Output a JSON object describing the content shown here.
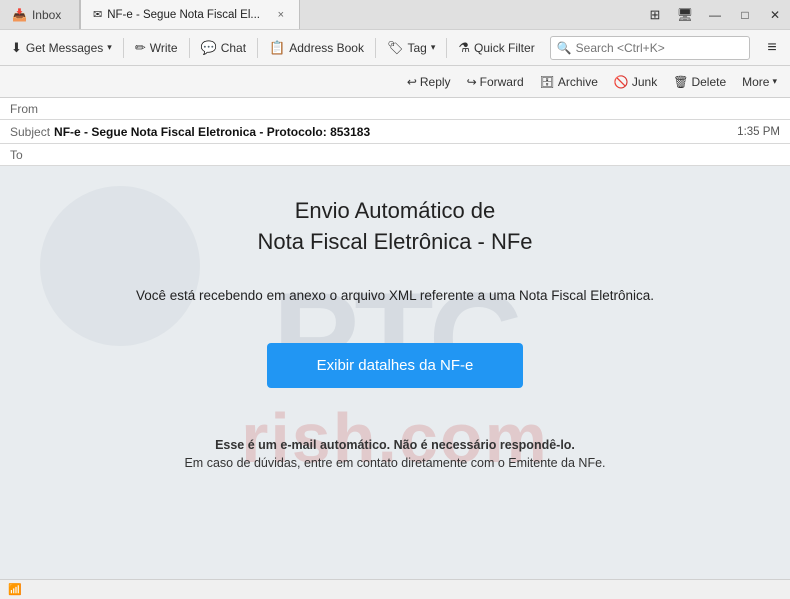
{
  "titlebar": {
    "tab_inactive_label": "Inbox",
    "tab_inactive_icon": "📥",
    "tab_active_label": "NF-e - Segue Nota Fiscal El...",
    "tab_active_close": "×",
    "window_controls": {
      "minimize": "—",
      "maximize": "□",
      "close": "✕"
    },
    "extra_icon": "⊞",
    "extra_icon2": "🖥"
  },
  "toolbar": {
    "get_messages": "Get Messages",
    "write": "Write",
    "chat": "Chat",
    "address_book": "Address Book",
    "tag": "Tag",
    "quick_filter": "Quick Filter",
    "search_placeholder": "Search <Ctrl+K>",
    "menu_icon": "≡"
  },
  "email_actions": {
    "reply": "Reply",
    "forward": "Forward",
    "archive": "Archive",
    "junk": "Junk",
    "delete": "Delete",
    "more": "More"
  },
  "email_header": {
    "from_label": "From",
    "subject_label": "Subject",
    "subject_value": "NF-e - Segue Nota Fiscal Eletronica - Protocolo: 853183",
    "time": "1:35 PM",
    "to_label": "To"
  },
  "email_body": {
    "title_line1": "Envio Automático de",
    "title_line2": "Nota Fiscal Eletrônica - NFe",
    "subtitle": "Você está recebendo em anexo o arquivo XML referente a uma Nota Fiscal Eletrônica.",
    "cta_button": "Exibir datalhes da NF-e",
    "footer_line1": "Esse é um e-mail automático. Não é necessário respondê-lo.",
    "footer_line2": "Em caso de dúvidas, entre em contato diretamente com o Emitente da NFe."
  },
  "watermark": {
    "top": "PTC",
    "bottom": "rish.com"
  },
  "statusbar": {
    "icon": "📶"
  }
}
